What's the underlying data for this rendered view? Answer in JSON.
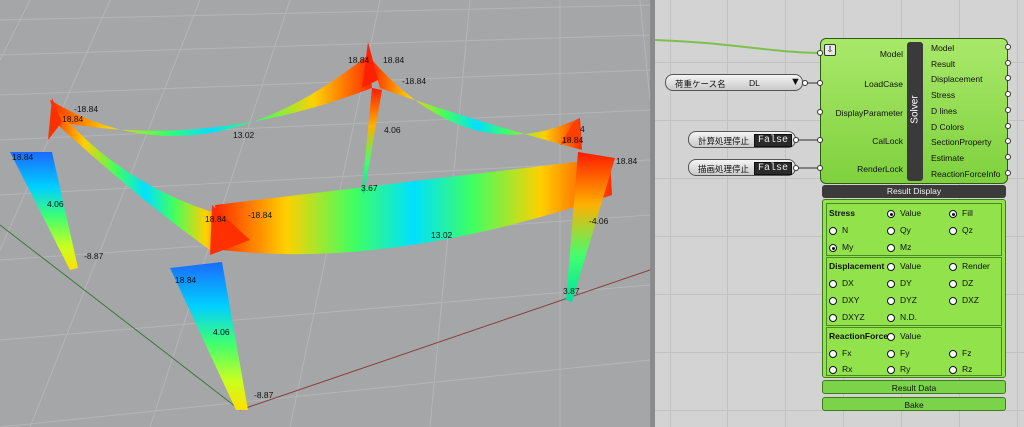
{
  "viewport": {
    "labels": {
      "l1": "-18.84",
      "l2": "18.84",
      "l3": "18.84",
      "l4": "18.84",
      "l5": "18.84",
      "l6": "-18.84",
      "l7": "4",
      "l8": "18.84",
      "l9": "18.84",
      "l10": "13.02",
      "l11": "4.06",
      "l12": "3.67",
      "l13": "4.06",
      "l14": "-8.87",
      "l15": "-18.84",
      "l16": "13.02",
      "l17": "-4.06",
      "l18": "3.87",
      "l19": "18.84",
      "l20": "4.06",
      "l21": "-8.87",
      "l22": "18.84"
    }
  },
  "canvas": {
    "params": {
      "loadcase_label": "荷重ケース名",
      "loadcase_value": "DL",
      "calclock_label": "計算処理停止",
      "calclock_value": "False",
      "renderlock_label": "描画処理停止",
      "renderlock_value": "False"
    },
    "component": {
      "name": "Solver",
      "inputs": [
        "Model",
        "LoadCase",
        "DisplayParameter",
        "CalLock",
        "RenderLock"
      ],
      "outputs": [
        "Model",
        "Result",
        "Displacement",
        "Stress",
        "D lines",
        "D Colors",
        "SectionProperty",
        "Estimate",
        "ReactionForceInfo"
      ],
      "result_display": "Result Display",
      "stress": {
        "title": "Stress",
        "value": "Value",
        "fill": "Fill",
        "n": "N",
        "qy": "Qy",
        "qz": "Qz",
        "my": "My",
        "mz": "Mz"
      },
      "displacement": {
        "title": "Displacement",
        "value": "Value",
        "render": "Render",
        "dx": "DX",
        "dy": "DY",
        "dz": "DZ",
        "dxy": "DXY",
        "dyz": "DYZ",
        "dxz": "DXZ",
        "dxyz": "DXYZ",
        "nd": "N.D."
      },
      "reaction": {
        "title": "ReactionForce",
        "value": "Value",
        "fx": "Fx",
        "fy": "Fy",
        "fz": "Fz",
        "rx": "Rx",
        "ry": "Ry",
        "rz": "Rz"
      },
      "result_data": "Result Data",
      "bake": "Bake"
    }
  }
}
